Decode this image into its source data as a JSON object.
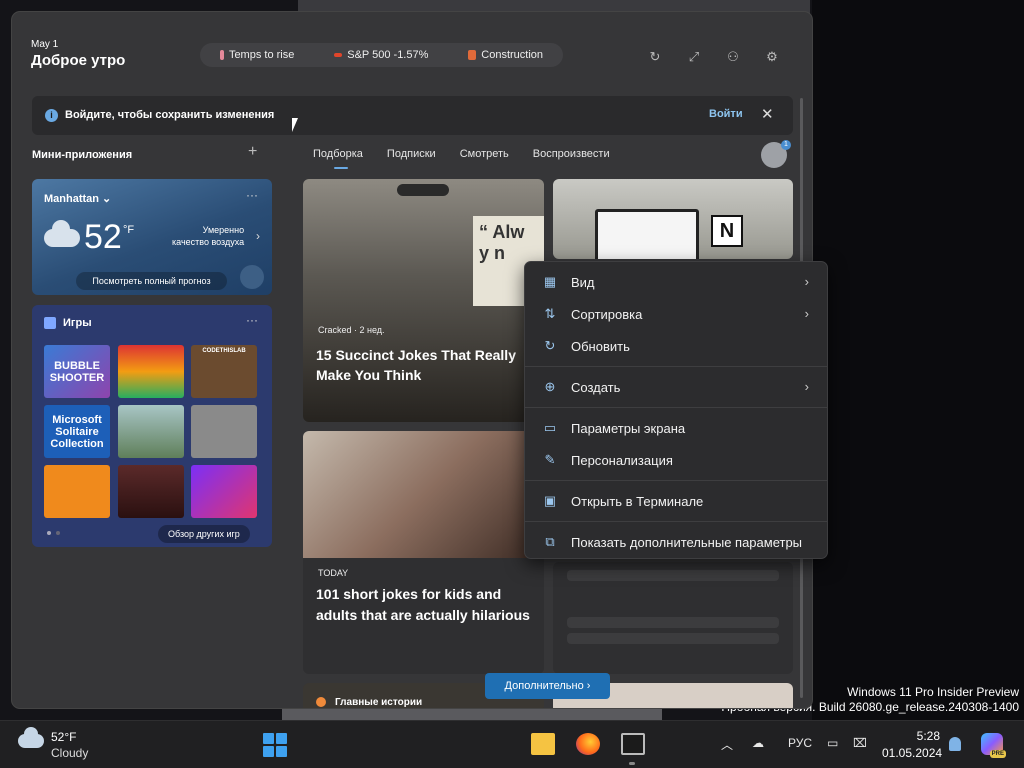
{
  "header": {
    "date": "May 1",
    "greeting": "Доброе утро",
    "chips": [
      "Temps to rise",
      "S&P 500 -1.57%",
      "Construction"
    ]
  },
  "signin_banner": {
    "message": "Войдите, чтобы сохранить изменения",
    "login_label": "Войти"
  },
  "widgets": {
    "title": "Мини-приложения",
    "weather": {
      "city": "Manhattan",
      "temp": "52",
      "unit": "°F",
      "air_quality_line1": "Умеренно",
      "air_quality_line2": "качество воздуха",
      "forecast_label": "Посмотреть полный прогноз"
    },
    "games": {
      "title": "Игры",
      "tiles": [
        "BUBBLE SHOOTER",
        "",
        "CODETHISLAB",
        "Microsoft Solitaire Collection",
        "",
        "",
        "",
        "",
        ""
      ],
      "more_label": "Обзор других игр"
    }
  },
  "feed": {
    "tabs": [
      "Подборка",
      "Подписки",
      "Смотреть",
      "Воспроизвести"
    ],
    "cards": [
      {
        "source": "Cracked · 2 нед.",
        "title": "15 Succinct Jokes That Really Make You Think",
        "quote": "“ Alw y n"
      },
      {
        "source": "TODAY",
        "title": "101 short jokes for kids and adults that are actually hilarious"
      },
      {
        "source": "Главные истории"
      }
    ],
    "more_label": "Дополнительно"
  },
  "context_menu": {
    "items": [
      {
        "label": "Вид",
        "icon": "grid-icon",
        "submenu": true
      },
      {
        "label": "Сортировка",
        "icon": "sort-icon",
        "submenu": true
      },
      {
        "label": "Обновить",
        "icon": "refresh-icon",
        "submenu": false
      },
      {
        "label": "Создать",
        "icon": "plus-circle-icon",
        "submenu": true
      },
      {
        "label": "Параметры экрана",
        "icon": "display-icon",
        "submenu": false
      },
      {
        "label": "Персонализация",
        "icon": "brush-icon",
        "submenu": false
      },
      {
        "label": "Открыть в Терминале",
        "icon": "terminal-icon",
        "submenu": false
      },
      {
        "label": "Показать дополнительные параметры",
        "icon": "expand-icon",
        "submenu": false
      }
    ]
  },
  "watermark": {
    "line1": "Windows 11 Pro Insider Preview",
    "line2": "Пробная версия. Build 26080.ge_release.240308-1400"
  },
  "taskbar": {
    "weather_temp": "52°F",
    "weather_cond": "Cloudy",
    "lang": "РУС",
    "time": "5:28",
    "date": "01.05.2024",
    "copilot_badge": "PRE"
  }
}
